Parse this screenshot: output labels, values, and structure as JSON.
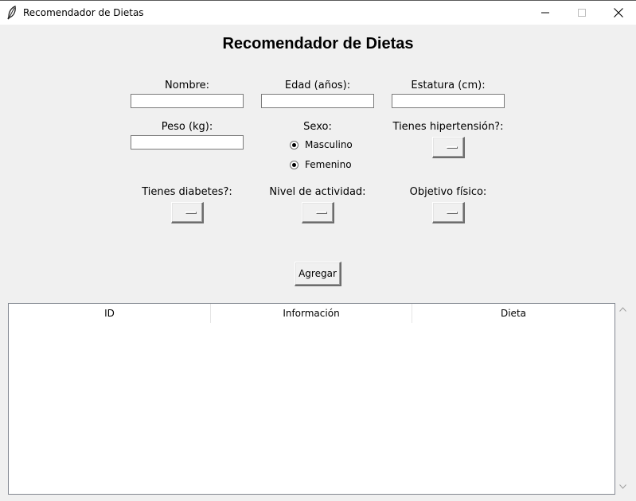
{
  "window": {
    "title": "Recomendador de Dietas",
    "icon": "feather-icon"
  },
  "app": {
    "title": "Recomendador de Dietas"
  },
  "form": {
    "nombre_label": "Nombre:",
    "nombre_value": "",
    "edad_label": "Edad (años):",
    "edad_value": "",
    "estatura_label": "Estatura (cm):",
    "estatura_value": "",
    "peso_label": "Peso (kg):",
    "peso_value": "",
    "sexo_label": "Sexo:",
    "sexo_options": [
      "Masculino",
      "Femenino"
    ],
    "hipertension_label": "Tienes hipertensión?:",
    "hipertension_value": "",
    "diabetes_label": "Tienes diabetes?:",
    "diabetes_value": "",
    "actividad_label": "Nivel de actividad:",
    "actividad_value": "",
    "objetivo_label": "Objetivo físico:",
    "objetivo_value": "",
    "add_button": "Agregar"
  },
  "table": {
    "columns": [
      "ID",
      "Información",
      "Dieta"
    ],
    "rows": []
  }
}
